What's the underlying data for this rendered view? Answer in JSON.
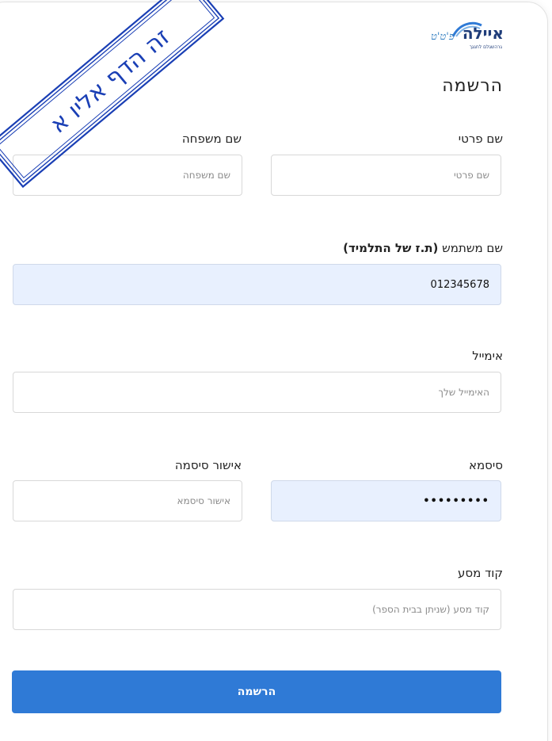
{
  "logo": {
    "main": "איילה",
    "script": "פ'ט'ט",
    "sub": "גרהשגלם לחגגך"
  },
  "form": {
    "title": "הרשמה",
    "first_name": {
      "label": "שם פרטי",
      "placeholder": "שם פרטי",
      "value": ""
    },
    "last_name": {
      "label": "שם משפחה",
      "placeholder": "שם משפחה",
      "value": ""
    },
    "username": {
      "label": "שם משתמש",
      "label_bold": "(ת.ז של התלמיד)",
      "value": "012345678"
    },
    "email": {
      "label": "אימייל",
      "placeholder": "האימייל שלך",
      "value": ""
    },
    "password": {
      "label": "סיסמא",
      "value": "•••••••••"
    },
    "confirm_password": {
      "label": "אישור סיסמה",
      "placeholder": "אישור סיסמא",
      "value": ""
    },
    "travel_code": {
      "label": "קוד מסע",
      "placeholder": "קוד מסע (שניתן בבית הספר)",
      "value": ""
    },
    "submit_label": "הרשמה"
  },
  "annotation": {
    "text": "זה הדף אליו א"
  },
  "colors": {
    "primary": "#2f7ad6",
    "autofill": "#e8f0fe",
    "stamp": "#1a3fb5",
    "logo": "#1f3d7a"
  }
}
